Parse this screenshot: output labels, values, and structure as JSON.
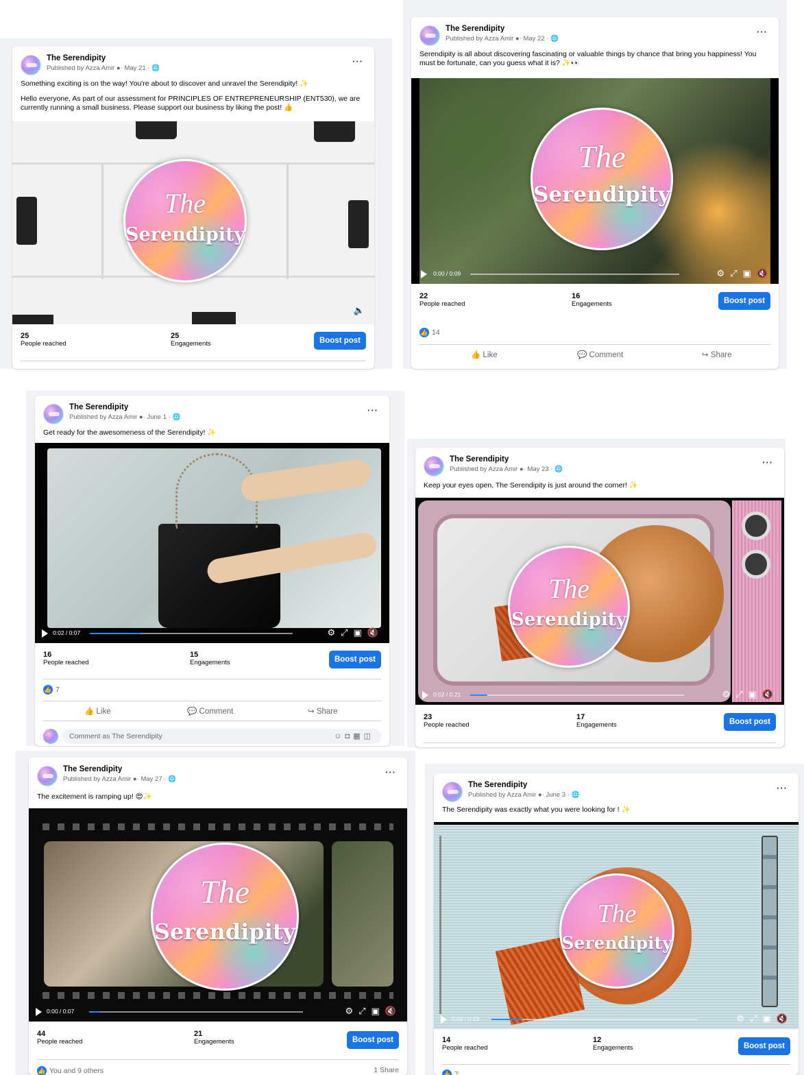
{
  "common": {
    "page_name": "The Serendipity",
    "publisher": "Published by Azza Amir",
    "boost": "Boost post",
    "reached_label": "People reached",
    "engagements_label": "Engagements",
    "like": "Like",
    "comment": "Comment",
    "share": "Share",
    "logo_line1": "The",
    "logo_line2": "Serendipity",
    "more": "···",
    "comment_placeholder": "Comment as The Serendipity"
  },
  "posts": [
    {
      "date": "· May 21 · ",
      "caption1": "Something exciting is on the way! You're about to discover and unravel the Serendipity! ✨",
      "caption2": "Hello everyone, As part of our assessment for PRINCIPLES OF ENTREPRENEURSHIP (ENT530), we are currently running a small business. Please support our business by liking the post! 👍",
      "reached": "25",
      "engagements": "25"
    },
    {
      "date": "· May 22 · ",
      "caption1": "Serendipity is all about discovering fascinating or valuable things by chance that bring you happiness! You must be fortunate, can you guess what it is? ✨👀",
      "time": "0:00 / 0:09",
      "progress": 0,
      "reached": "22",
      "engagements": "16",
      "reactions": "14"
    },
    {
      "date": "· June 1 · ",
      "caption1": "Get ready for the awesomeness of the Serendipity! ✨",
      "time": "0:02 / 0:07",
      "progress": 0.25,
      "reached": "16",
      "engagements": "15",
      "reactions": "7"
    },
    {
      "date": "· May 23 · ",
      "caption1": "Keep your eyes open, The Serendipity is just around the corner! ✨",
      "time": "0:02 / 0:21",
      "progress": 0.08,
      "reached": "23",
      "engagements": "17"
    },
    {
      "date": "· May 27 · ",
      "caption1": "The excitement is ramping up! 😍✨",
      "time": "0:00 / 0:07",
      "progress": 0.05,
      "reached": "44",
      "engagements": "21",
      "reactions": "You and 9 others",
      "shares": "1 Share"
    },
    {
      "date": "· June 3 · ",
      "caption1": "The Serendipity was exactly what you were looking for ! ✨",
      "time": "0:02 / 0:13",
      "progress": 0.15,
      "reached": "14",
      "engagements": "12",
      "reactions": "7"
    }
  ]
}
